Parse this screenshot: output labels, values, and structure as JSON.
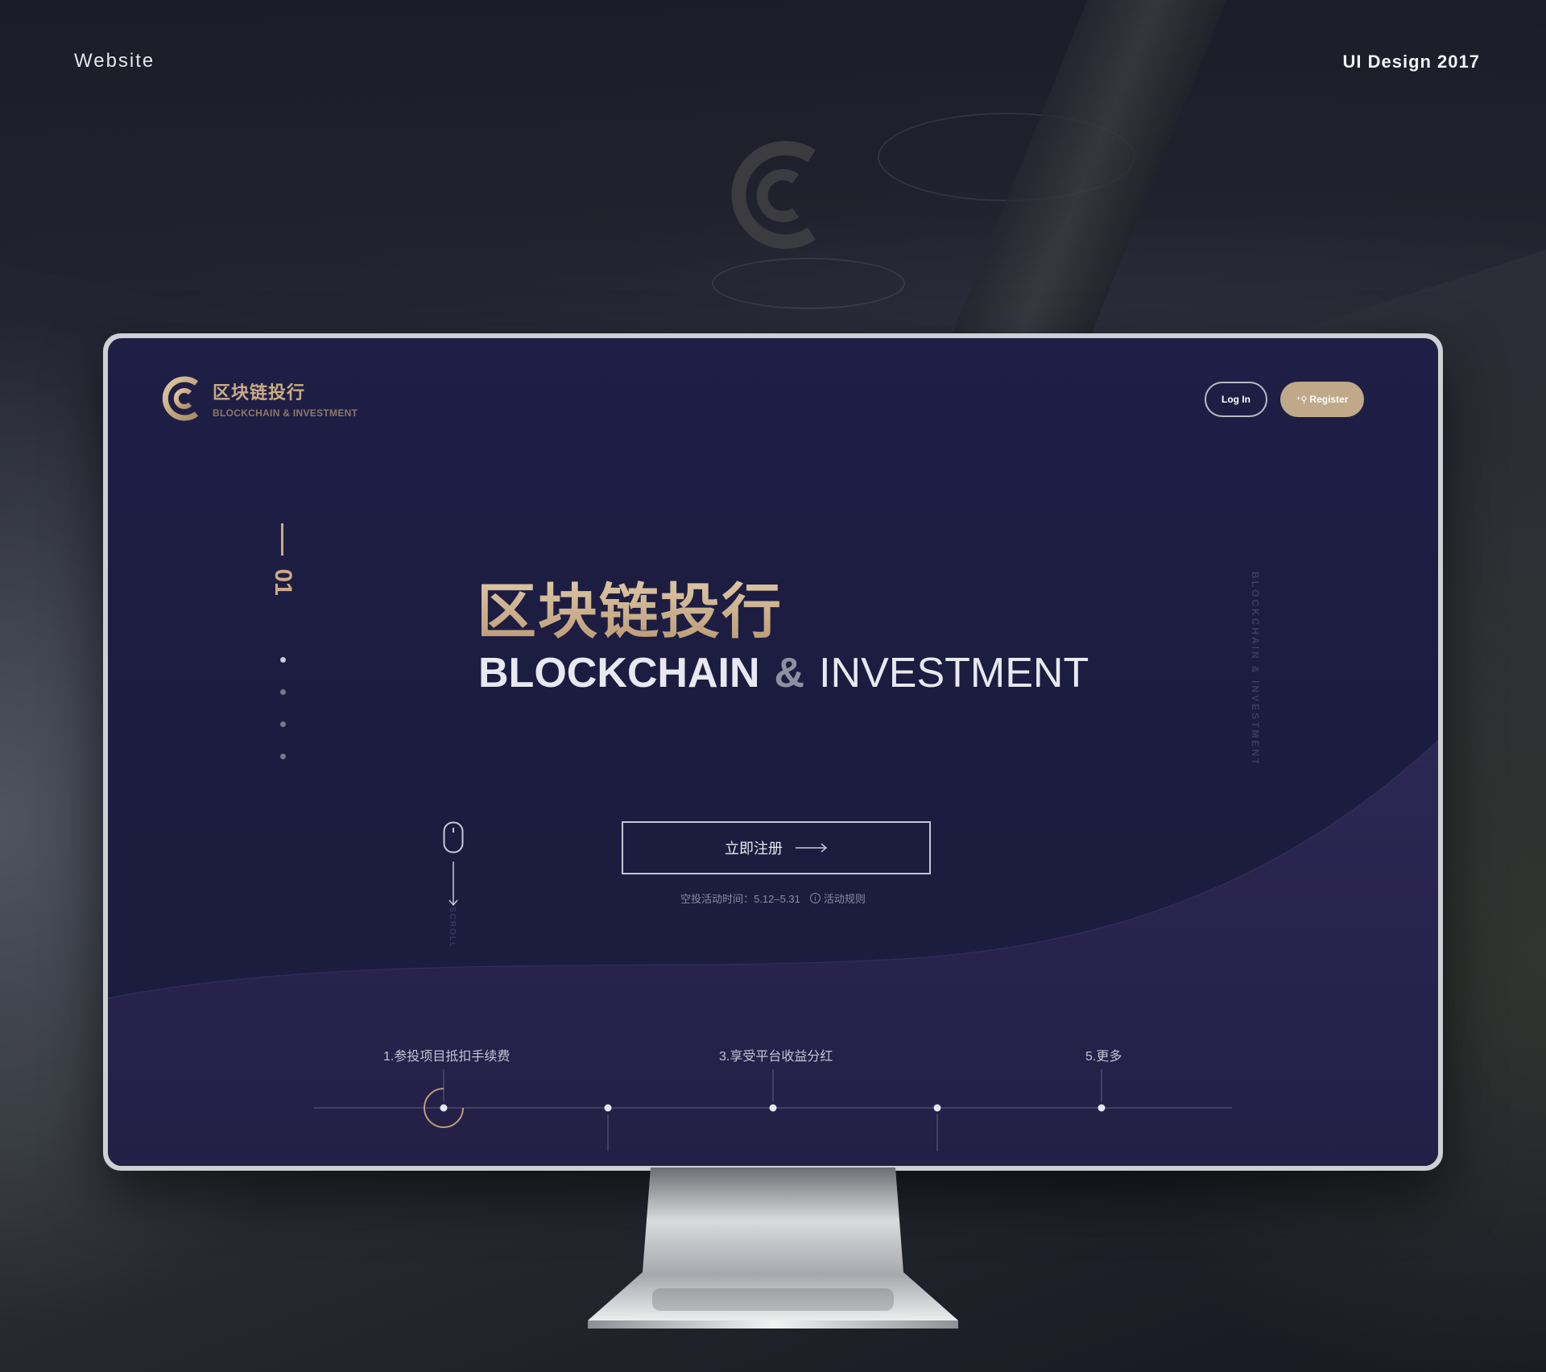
{
  "corner": {
    "left": "Website",
    "right": "UI Design 2017"
  },
  "brand": {
    "name_cn": "区块链投行",
    "name_en": "BLOCKCHAIN & INVESTMENT",
    "logo_icon": "c-logo-icon"
  },
  "header": {
    "login_label": "Log In",
    "register_label": "Register",
    "register_icon": "user-plus-icon"
  },
  "pager": {
    "current": "01",
    "dots": 4
  },
  "hero": {
    "title_cn": "区块链投行",
    "title_en_bold": "BLOCKCHAIN",
    "title_en_amp": "&",
    "title_en_light": "INVESTMENT",
    "vertical_text": "BLOCKCHAIN  &  INVESTMENT"
  },
  "cta": {
    "label": "立即注册",
    "arrow_icon": "long-arrow-right-icon"
  },
  "airdrop": {
    "text": "空投活动时间：5.12–5.31",
    "rules_label": "活动规则",
    "rules_icon": "info-icon"
  },
  "scroll": {
    "label": "SCROLL",
    "icon": "mouse-icon"
  },
  "timeline": {
    "items": [
      {
        "label": "1.参投项目抵扣手续费",
        "active": true
      },
      {
        "label": "",
        "active": false
      },
      {
        "label": "3.享受平台收益分红",
        "active": false
      },
      {
        "label": "",
        "active": false
      },
      {
        "label": "5.更多",
        "active": false
      }
    ]
  },
  "colors": {
    "gold": "#c9ab86",
    "screen_bg": "#1f1f46",
    "button_fill": "#bfa989"
  }
}
